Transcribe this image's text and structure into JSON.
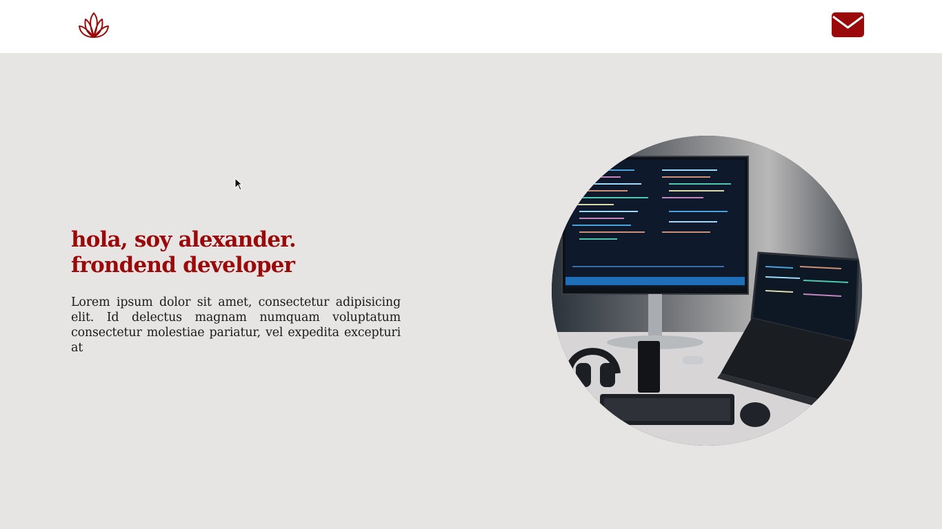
{
  "header": {
    "logo_icon": "lotus-icon",
    "mail_icon": "envelope-icon"
  },
  "hero": {
    "title": "hola, soy alexander. frondend developer",
    "description": "Lorem ipsum dolor sit amet, consectetur adipisicing elit. Id delectus magnam numquam voluptatum consectetur molestiae pariatur, vel expedita excepturi at",
    "photo_alt": "desk-setup-photo"
  },
  "colors": {
    "accent": "#9b0a0a",
    "background": "#e7e5e4",
    "header_bg": "#ffffff",
    "text": "#1a1a1a"
  }
}
